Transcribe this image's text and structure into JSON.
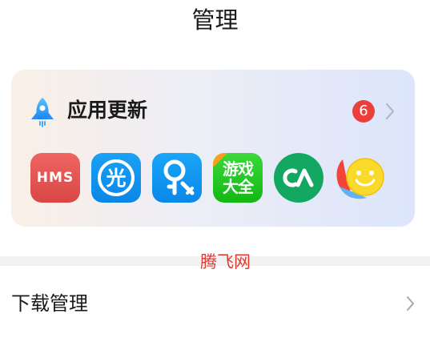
{
  "header": {
    "title": "管理"
  },
  "update_card": {
    "title": "应用更新",
    "badge_count": "6",
    "icons": [
      {
        "name": "rocket-icon"
      },
      {
        "name": "chevron-right-icon"
      }
    ],
    "apps": [
      {
        "name": "hms-app-icon",
        "label": "HMS"
      },
      {
        "name": "guang-app-icon",
        "label": "光"
      },
      {
        "name": "key-app-icon"
      },
      {
        "name": "game-center-app-icon",
        "label": "游戏大全"
      },
      {
        "name": "ca-app-icon"
      },
      {
        "name": "smile-app-icon"
      }
    ]
  },
  "watermark": {
    "text": "腾飞网"
  },
  "download": {
    "label": "下载管理"
  },
  "colors": {
    "badge": "#ea3f3a",
    "watermark": "#e23a33",
    "hms": "#e05452",
    "blue_app": "#1196ee",
    "green_app": "#22c822",
    "ca_app": "#13a862"
  }
}
